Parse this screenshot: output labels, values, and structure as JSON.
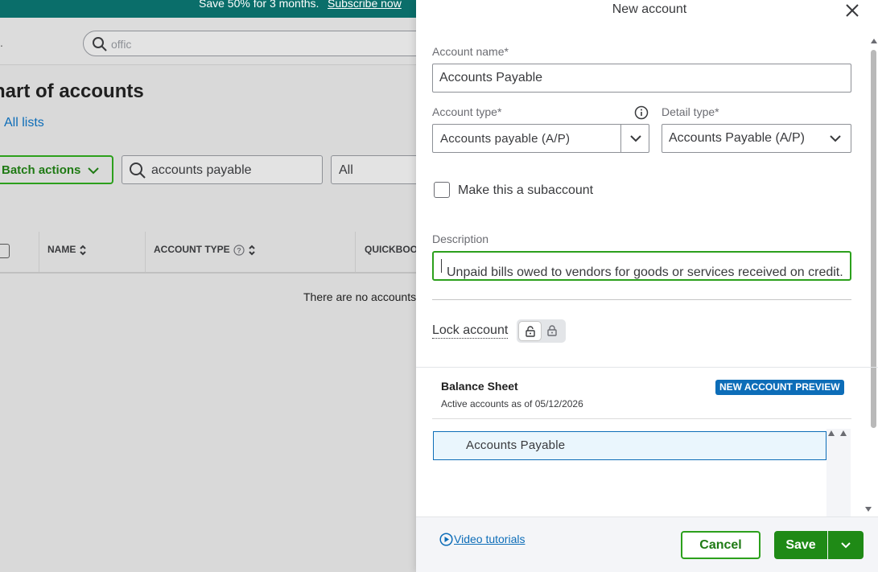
{
  "background": {
    "promo": {
      "text": "Save 50% for 3 months.",
      "link": "Subscribe now"
    },
    "topbar": {
      "dot": ".",
      "search_value": "offic"
    },
    "page_title": "hart of accounts",
    "all_lists_link": "All lists",
    "batch_actions_label": "Batch actions",
    "list_search_value": "accounts payable",
    "filter_value": "All",
    "table": {
      "columns": [
        "NAME",
        "ACCOUNT TYPE",
        "QUICKBOOKS"
      ],
      "empty_message": "There are no accounts"
    }
  },
  "drawer": {
    "title": "New account",
    "account_name": {
      "label": "Account name*",
      "value": "Accounts Payable"
    },
    "account_type": {
      "label": "Account type*",
      "value": "Accounts payable (A/P)"
    },
    "detail_type": {
      "label": "Detail type*",
      "value": "Accounts Payable (A/P)"
    },
    "subaccount": {
      "label": "Make this a subaccount",
      "checked": false
    },
    "description": {
      "label": "Description",
      "value": "Unpaid bills owed to vendors for goods or services received on credit."
    },
    "lock": {
      "label": "Lock account",
      "locked": true
    },
    "preview": {
      "title": "Balance Sheet",
      "badge": "NEW ACCOUNT PREVIEW",
      "subtitle": "Active accounts as of 05/12/2026",
      "row": "Accounts Payable"
    },
    "footer": {
      "video_link": "Video tutorials",
      "cancel": "Cancel",
      "save": "Save"
    }
  },
  "colors": {
    "brand_green": "#2ca01c",
    "save_green": "#1f8a16",
    "link_blue": "#0d6db8",
    "promo_teal": "#0a6e6a",
    "overlay_gray": "#d9d9d9"
  }
}
